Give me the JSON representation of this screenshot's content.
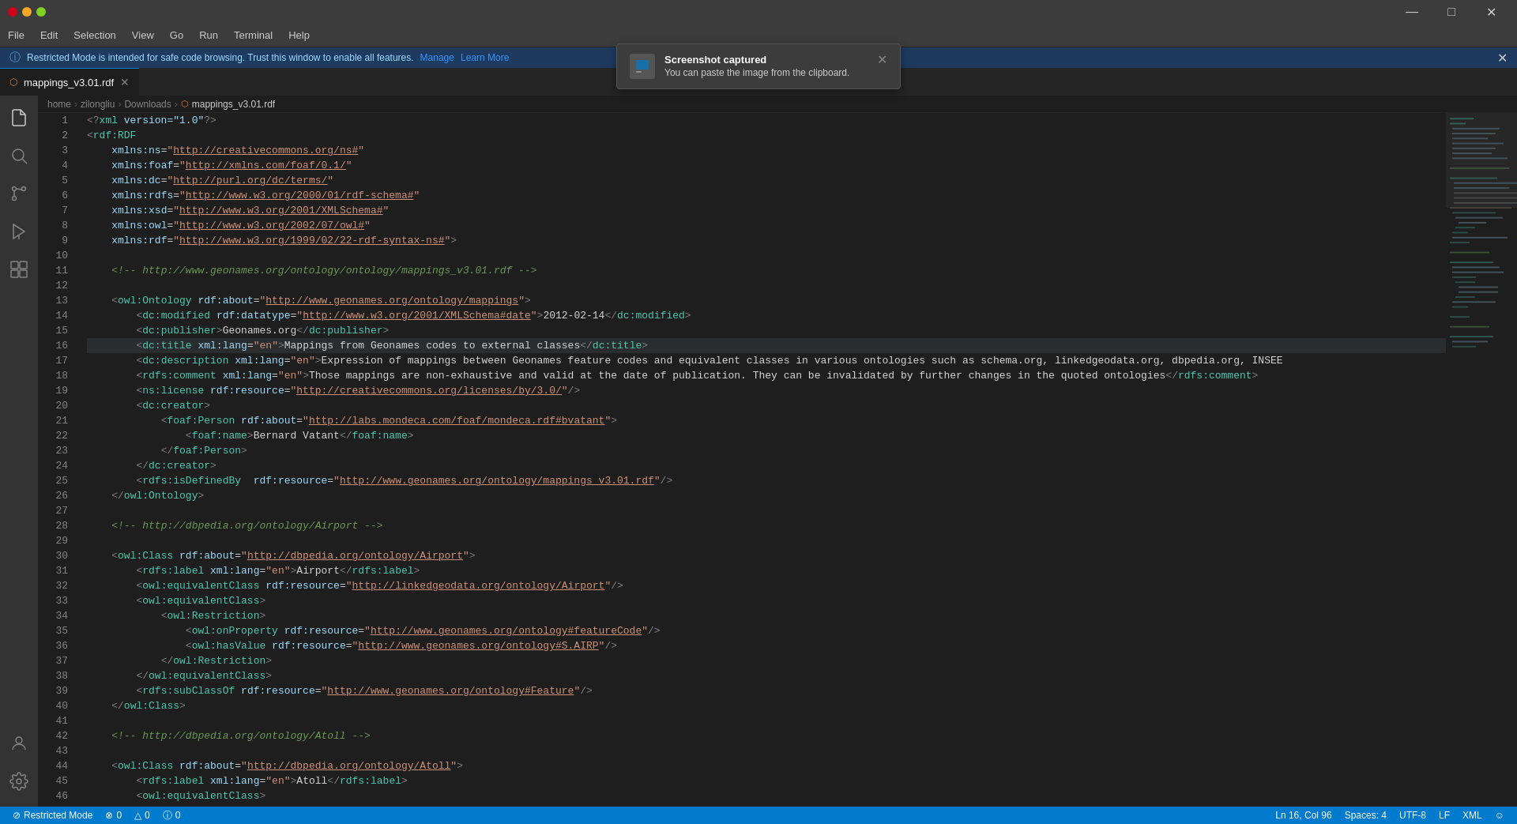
{
  "titlebar": {
    "controls": {
      "minimize": "—",
      "maximize": "□",
      "close": "✕"
    }
  },
  "menubar": {
    "items": [
      "File",
      "Edit",
      "Selection",
      "View",
      "Go",
      "Run",
      "Terminal",
      "Help"
    ]
  },
  "restricted_bar": {
    "message": "Restricted Mode is intended for safe code browsing. Trust this window to enable all features.",
    "manage_label": "Manage",
    "learn_more_label": "Learn More",
    "close_label": "✕"
  },
  "tab": {
    "filename": "mappings_v3.01.rdf",
    "close_label": "✕"
  },
  "breadcrumb": {
    "home": "home",
    "user": "zilongliu",
    "folder": "Downloads",
    "file": "mappings_v3.01.rdf"
  },
  "toast": {
    "title": "Screenshot captured",
    "body": "You can paste the image from the clipboard.",
    "close_label": "✕"
  },
  "statusbar": {
    "restricted_mode": "⊘ Restricted Mode",
    "errors": "⊗ 0",
    "warnings": "△ 0",
    "info": "ⓘ 0",
    "line_col": "Ln 16, Col 96",
    "spaces": "Spaces: 4",
    "encoding": "UTF-8",
    "line_ending": "LF",
    "language": "XML",
    "feedback": "☺"
  },
  "code": {
    "lines": [
      {
        "num": 1,
        "content": "<?xml version=\"1.0\"?>"
      },
      {
        "num": 2,
        "content": "<rdf:RDF"
      },
      {
        "num": 3,
        "content": "    xmlns:ns=\"http://creativecommons.org/ns#\""
      },
      {
        "num": 4,
        "content": "    xmlns:foaf=\"http://xmlns.com/foaf/0.1/\""
      },
      {
        "num": 5,
        "content": "    xmlns:dc=\"http://purl.org/dc/terms/\""
      },
      {
        "num": 6,
        "content": "    xmlns:rdfs=\"http://www.w3.org/2000/01/rdf-schema#\""
      },
      {
        "num": 7,
        "content": "    xmlns:xsd=\"http://www.w3.org/2001/XMLSchema#\""
      },
      {
        "num": 8,
        "content": "    xmlns:owl=\"http://www.w3.org/2002/07/owl#\""
      },
      {
        "num": 9,
        "content": "    xmlns:rdf=\"http://www.w3.org/1999/02/22-rdf-syntax-ns#\">"
      },
      {
        "num": 10,
        "content": ""
      },
      {
        "num": 11,
        "content": "    <!-- http://www.geonames.org/ontology/ontology/mappings_v3.01.rdf -->"
      },
      {
        "num": 12,
        "content": ""
      },
      {
        "num": 13,
        "content": "    <owl:Ontology rdf:about=\"http://www.geonames.org/ontology/mappings\">"
      },
      {
        "num": 14,
        "content": "        <dc:modified rdf:datatype=\"http://www.w3.org/2001/XMLSchema#date\">2012-02-14</dc:modified>"
      },
      {
        "num": 15,
        "content": "        <dc:publisher>Geonames.org</dc:publisher>"
      },
      {
        "num": 16,
        "content": "        <dc:title xml:lang=\"en\">Mappings from Geonames codes to external classes</dc:title>",
        "cursor": true
      },
      {
        "num": 17,
        "content": "        <dc:description xml:lang=\"en\">Expression of mappings between Geonames feature codes and equivalent classes in various ontologies such as schema.org, linkedgeodata.org, dbpedia.org, INSEE"
      },
      {
        "num": 18,
        "content": "        <rdfs:comment xml:lang=\"en\">Those mappings are non-exhaustive and valid at the date of publication. They can be invalidated by further changes in the quoted ontologies</rdfs:comment>"
      },
      {
        "num": 19,
        "content": "        <ns:license rdf:resource=\"http://creativecommons.org/licenses/by/3.0/\"/>"
      },
      {
        "num": 20,
        "content": "        <dc:creator>"
      },
      {
        "num": 21,
        "content": "            <foaf:Person rdf:about=\"http://labs.mondeca.com/foaf/mondeca.rdf#bvatant\">"
      },
      {
        "num": 22,
        "content": "                <foaf:name>Bernard Vatant</foaf:name>"
      },
      {
        "num": 23,
        "content": "            </foaf:Person>"
      },
      {
        "num": 24,
        "content": "        </dc:creator>"
      },
      {
        "num": 25,
        "content": "        <rdfs:isDefinedBy  rdf:resource=\"http://www.geonames.org/ontology/mappings_v3.01.rdf\"/>"
      },
      {
        "num": 26,
        "content": "    </owl:Ontology>"
      },
      {
        "num": 27,
        "content": ""
      },
      {
        "num": 28,
        "content": "    <!-- http://dbpedia.org/ontology/Airport -->"
      },
      {
        "num": 29,
        "content": ""
      },
      {
        "num": 30,
        "content": "    <owl:Class rdf:about=\"http://dbpedia.org/ontology/Airport\">"
      },
      {
        "num": 31,
        "content": "        <rdfs:label xml:lang=\"en\">Airport</rdfs:label>"
      },
      {
        "num": 32,
        "content": "        <owl:equivalentClass rdf:resource=\"http://linkedgeodata.org/ontology/Airport\"/>"
      },
      {
        "num": 33,
        "content": "        <owl:equivalentClass>"
      },
      {
        "num": 34,
        "content": "            <owl:Restriction>"
      },
      {
        "num": 35,
        "content": "                <owl:onProperty rdf:resource=\"http://www.geonames.org/ontology#featureCode\"/>"
      },
      {
        "num": 36,
        "content": "                <owl:hasValue rdf:resource=\"http://www.geonames.org/ontology#S.AIRP\"/>"
      },
      {
        "num": 37,
        "content": "            </owl:Restriction>"
      },
      {
        "num": 38,
        "content": "        </owl:equivalentClass>"
      },
      {
        "num": 39,
        "content": "        <rdfs:subClassOf rdf:resource=\"http://www.geonames.org/ontology#Feature\"/>"
      },
      {
        "num": 40,
        "content": "    </owl:Class>"
      },
      {
        "num": 41,
        "content": ""
      },
      {
        "num": 42,
        "content": "    <!-- http://dbpedia.org/ontology/Atoll -->"
      },
      {
        "num": 43,
        "content": ""
      },
      {
        "num": 44,
        "content": "    <owl:Class rdf:about=\"http://dbpedia.org/ontology/Atoll\">"
      },
      {
        "num": 45,
        "content": "        <rdfs:label xml:lang=\"en\">Atoll</rdfs:label>"
      },
      {
        "num": 46,
        "content": "        <owl:equivalentClass>"
      }
    ]
  }
}
